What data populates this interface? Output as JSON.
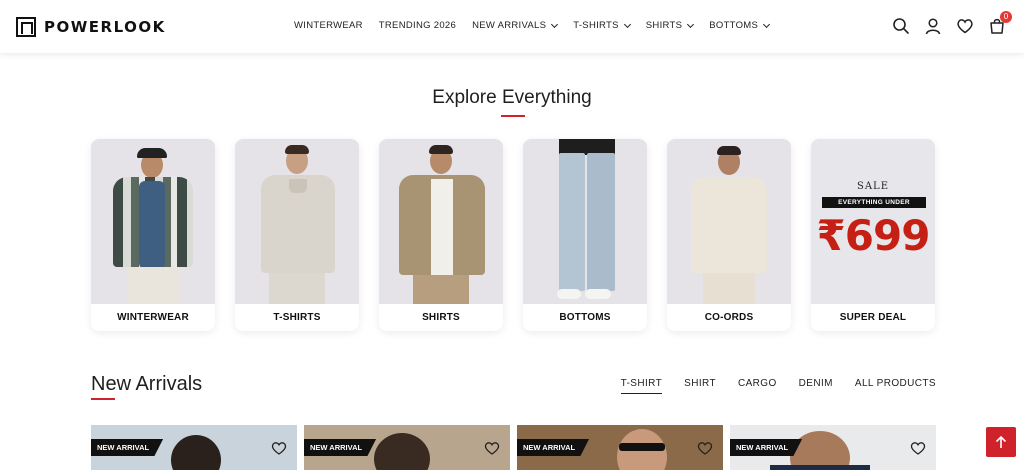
{
  "brand": {
    "name": "POWERLOOK"
  },
  "nav": [
    {
      "label": "WINTERWEAR",
      "has_menu": false
    },
    {
      "label": "TRENDING 2026",
      "has_menu": false
    },
    {
      "label": "NEW ARRIVALS",
      "has_menu": true
    },
    {
      "label": "T-SHIRTS",
      "has_menu": true
    },
    {
      "label": "SHIRTS",
      "has_menu": true
    },
    {
      "label": "BOTTOMS",
      "has_menu": true
    }
  ],
  "header_icons": [
    "search-icon",
    "user-icon",
    "heart-icon",
    "cart-icon"
  ],
  "cart_count": "0",
  "explore": {
    "title": "Explore Everything",
    "categories": [
      {
        "label": "WINTERWEAR"
      },
      {
        "label": "T-SHIRTS"
      },
      {
        "label": "SHIRTS"
      },
      {
        "label": "BOTTOMS"
      },
      {
        "label": "CO-ORDS"
      },
      {
        "label": "SUPER DEAL"
      }
    ],
    "deal": {
      "sale": "SALE",
      "banner": "EVERYTHING UNDER",
      "price": "₹699"
    }
  },
  "new_arrivals": {
    "title": "New Arrivals",
    "tabs": [
      {
        "label": "T-SHIRT",
        "active": true
      },
      {
        "label": "SHIRT",
        "active": false
      },
      {
        "label": "CARGO",
        "active": false
      },
      {
        "label": "DENIM",
        "active": false
      },
      {
        "label": "ALL PRODUCTS",
        "active": false
      }
    ],
    "products": [
      {
        "tag": "NEW ARRIVAL"
      },
      {
        "tag": "NEW ARRIVAL"
      },
      {
        "tag": "NEW ARRIVAL"
      },
      {
        "tag": "NEW ARRIVAL"
      }
    ]
  },
  "colors": {
    "accent": "#d0222b",
    "deal_price": "#c62015",
    "text": "#1f1f1f"
  }
}
